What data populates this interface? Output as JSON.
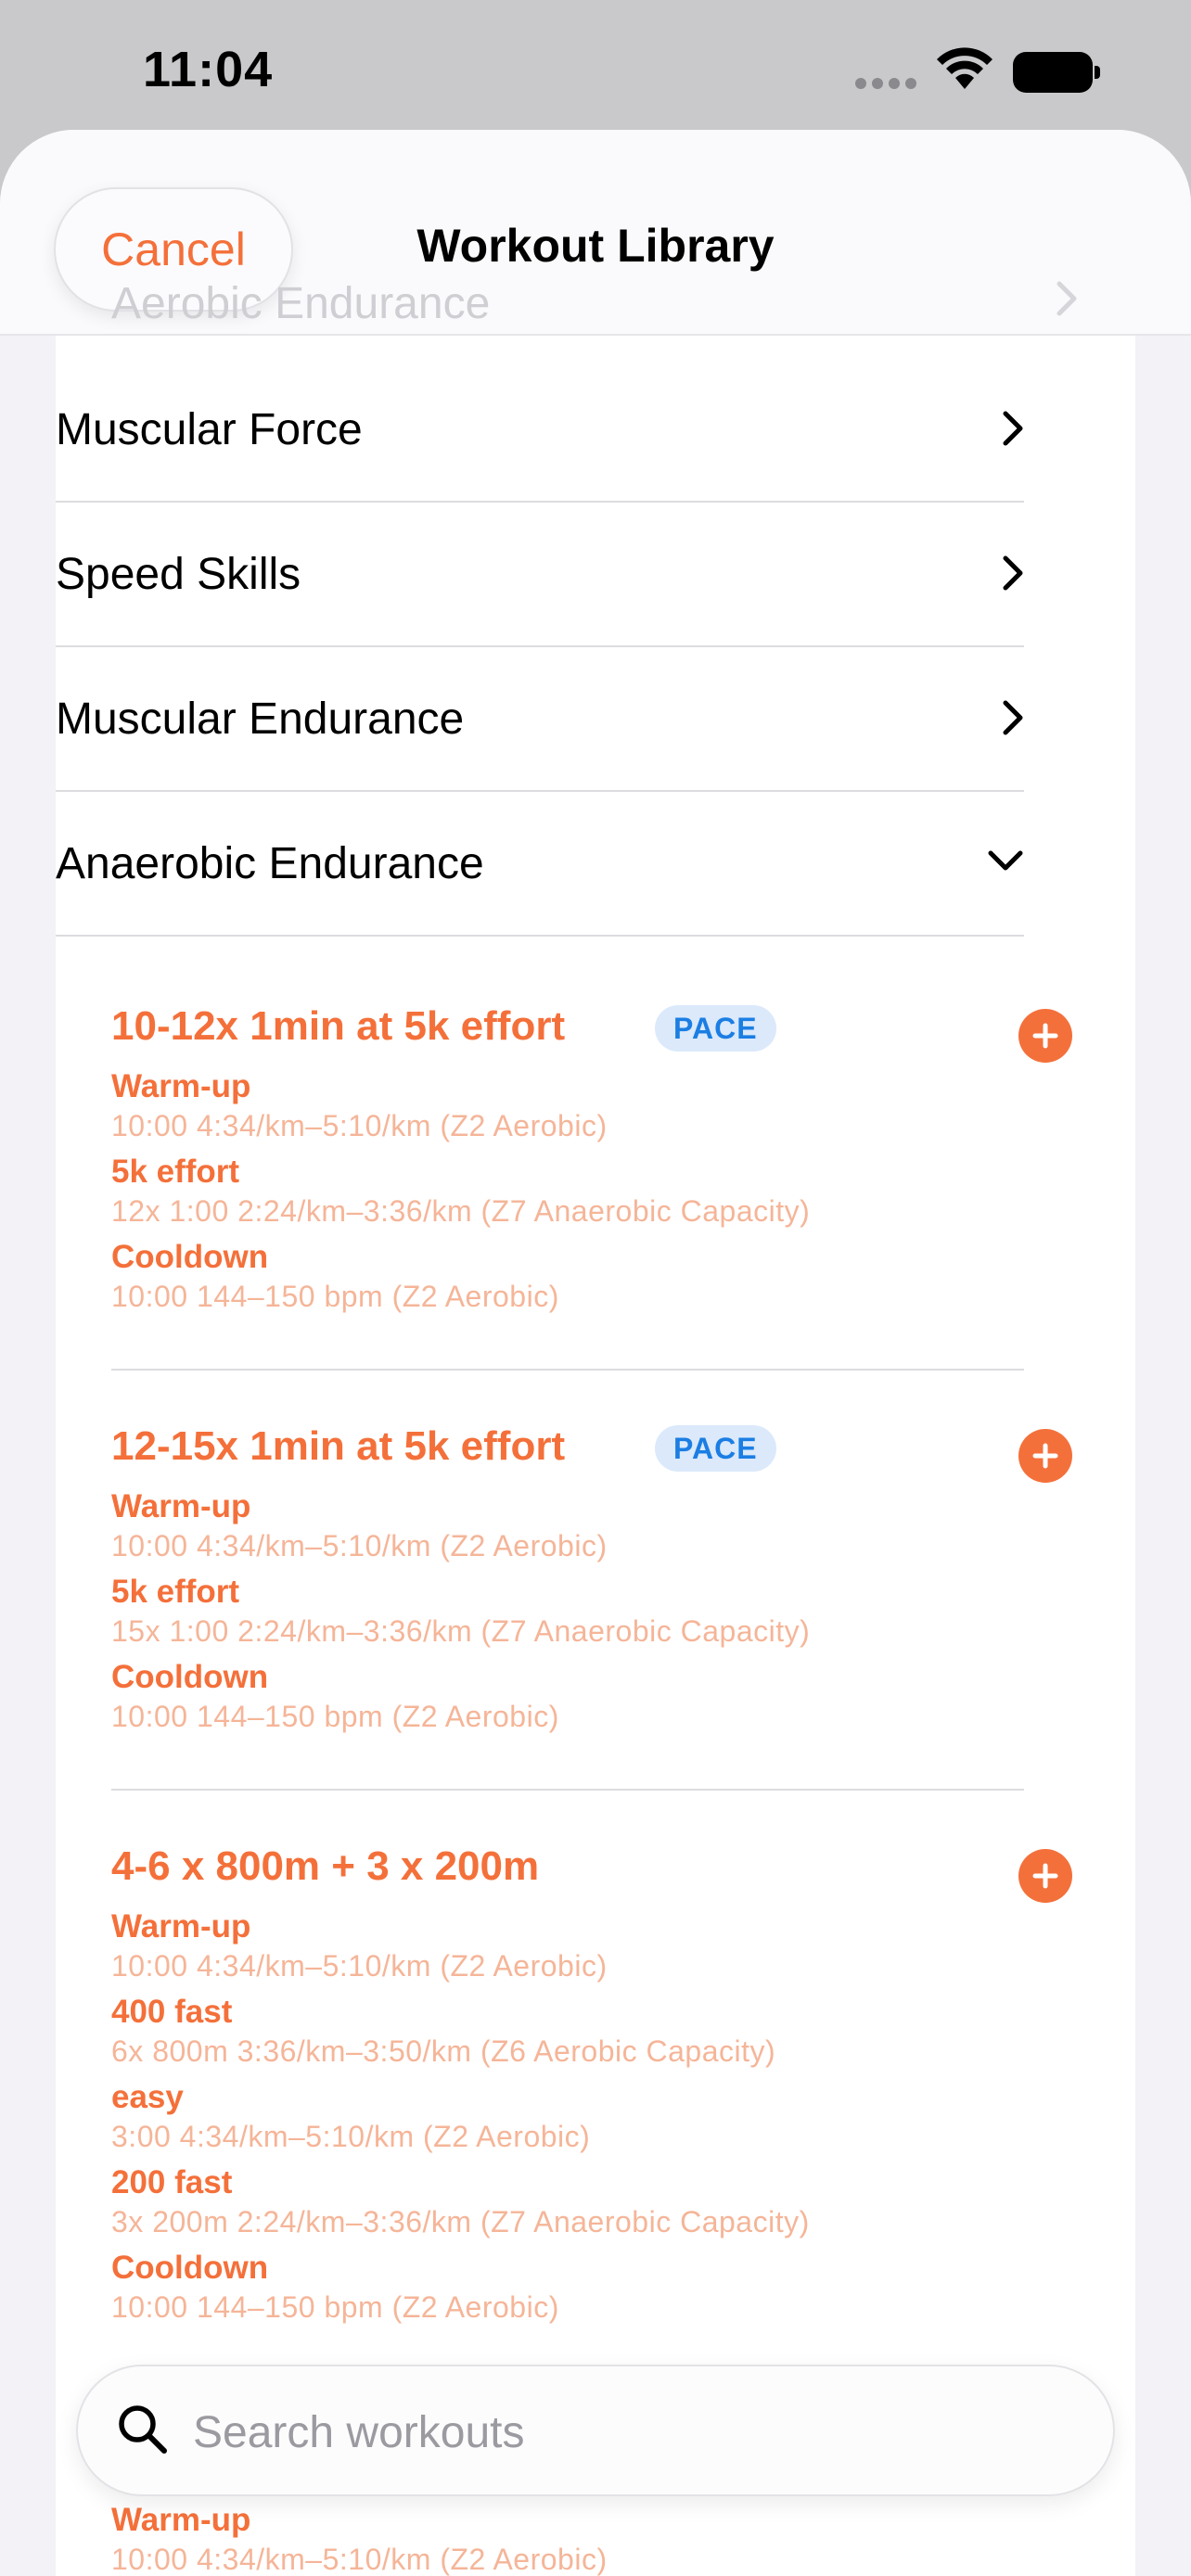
{
  "status_bar": {
    "time": "11:04"
  },
  "nav": {
    "cancel_label": "Cancel",
    "title": "Workout Library"
  },
  "categories_above": [
    "Aerobic Endurance"
  ],
  "categories": [
    {
      "label": "Muscular Force",
      "expanded": false
    },
    {
      "label": "Speed Skills",
      "expanded": false
    },
    {
      "label": "Muscular Endurance",
      "expanded": false
    },
    {
      "label": "Anaerobic Endurance",
      "expanded": true
    }
  ],
  "workouts": [
    {
      "title": "10-12x 1min at 5k effort",
      "badge": "PACE",
      "steps": [
        {
          "name": "Warm-up",
          "detail": "10:00 4:34/km–5:10/km (Z2 Aerobic)"
        },
        {
          "name": "5k effort",
          "detail": "12x 1:00 2:24/km–3:36/km (Z7 Anaerobic Capacity)"
        },
        {
          "name": "Cooldown",
          "detail": "10:00 144–150 bpm (Z2 Aerobic)"
        }
      ]
    },
    {
      "title": "12-15x 1min at 5k effort",
      "badge": "PACE",
      "steps": [
        {
          "name": "Warm-up",
          "detail": "10:00 4:34/km–5:10/km (Z2 Aerobic)"
        },
        {
          "name": "5k effort",
          "detail": "15x 1:00 2:24/km–3:36/km (Z7 Anaerobic Capacity)"
        },
        {
          "name": "Cooldown",
          "detail": "10:00 144–150 bpm (Z2 Aerobic)"
        }
      ]
    },
    {
      "title": "4-6 x 800m + 3 x 200m",
      "badge": "",
      "steps": [
        {
          "name": "Warm-up",
          "detail": "10:00 4:34/km–5:10/km (Z2 Aerobic)"
        },
        {
          "name": "400 fast",
          "detail": "6x 800m 3:36/km–3:50/km (Z6 Aerobic Capacity)"
        },
        {
          "name": "easy",
          "detail": "3:00 4:34/km–5:10/km (Z2 Aerobic)"
        },
        {
          "name": "200 fast",
          "detail": "3x 200m 2:24/km–3:36/km (Z7 Anaerobic Capacity)"
        },
        {
          "name": "Cooldown",
          "detail": "10:00 144–150 bpm (Z2 Aerobic)"
        }
      ]
    },
    {
      "title": "",
      "badge": "",
      "steps": [
        {
          "name": "Warm-up",
          "detail": "10:00 4:34/km–5:10/km (Z2 Aerobic)"
        }
      ]
    }
  ],
  "search": {
    "placeholder": "Search workouts"
  },
  "colors": {
    "accent": "#f4703a",
    "badge_text": "#1b7ee3",
    "badge_bg": "#dbe9fb",
    "detail_text": "#f5b598"
  }
}
